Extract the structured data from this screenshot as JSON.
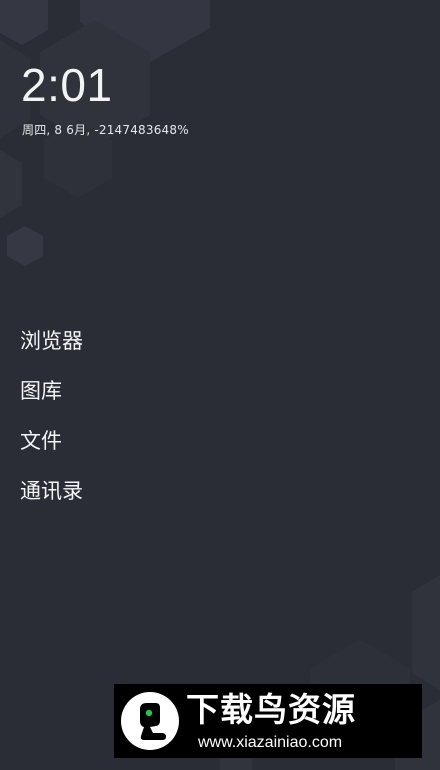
{
  "lockscreen": {
    "time": "2:01",
    "date": "周四, 8 6月, -2147483648%"
  },
  "shortcuts": [
    {
      "label": "浏览器"
    },
    {
      "label": "图库"
    },
    {
      "label": "文件"
    },
    {
      "label": "通讯录"
    }
  ],
  "watermark": {
    "title": "下载鸟资源",
    "url": "www.xiazainiao.com"
  },
  "colors": {
    "background": "#2a2d35",
    "hexagon": "#353842",
    "text": "#f4f5f7",
    "logo_green": "#2fbf4f"
  }
}
